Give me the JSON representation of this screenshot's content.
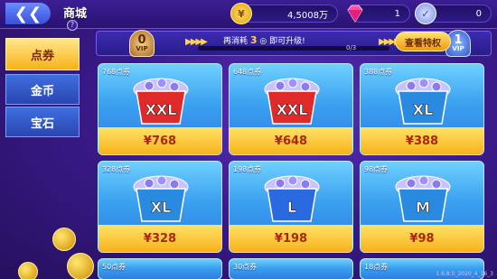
{
  "header": {
    "title": "商城",
    "back_icon": "chevron-left-icon",
    "help_label": "?"
  },
  "resources": {
    "coins": "4,5008万",
    "gems": "1",
    "tickets": "0",
    "coin_icon_glyph": "¥"
  },
  "menu": {
    "items": [
      {
        "label": "点券",
        "active": true
      },
      {
        "label": "金币",
        "active": false
      },
      {
        "label": "宝石",
        "active": false
      }
    ]
  },
  "vip": {
    "current_level": "0",
    "next_level": "1",
    "badge_label": "VIP",
    "text_before": "再消耗",
    "amount": "3",
    "text_after": "即可升级!",
    "progress_text": "0/3",
    "progress_fraction": 0.0,
    "privilege_button": "查看特权"
  },
  "products": [
    {
      "tag": "768点券",
      "price": "¥768",
      "badge": "XXL"
    },
    {
      "tag": "648点券",
      "price": "¥648",
      "badge": "XXL"
    },
    {
      "tag": "388点券",
      "price": "¥388",
      "badge": "XL"
    },
    {
      "tag": "328点券",
      "price": "¥328",
      "badge": "XL"
    },
    {
      "tag": "198点券",
      "price": "¥198",
      "badge": "L"
    },
    {
      "tag": "98点券",
      "price": "¥98",
      "badge": "M"
    },
    {
      "tag": "50点券",
      "price": "",
      "badge": ""
    },
    {
      "tag": "30点券",
      "price": "",
      "badge": ""
    },
    {
      "tag": "18点券",
      "price": "",
      "badge": ""
    }
  ],
  "version": "1.6.8.5_2020_4_16_3",
  "colors": {
    "accent_gold": "#f7b31a",
    "card_blue": "#3aa0f0",
    "price_red": "#a8280a",
    "background": "#3a1a8a"
  }
}
